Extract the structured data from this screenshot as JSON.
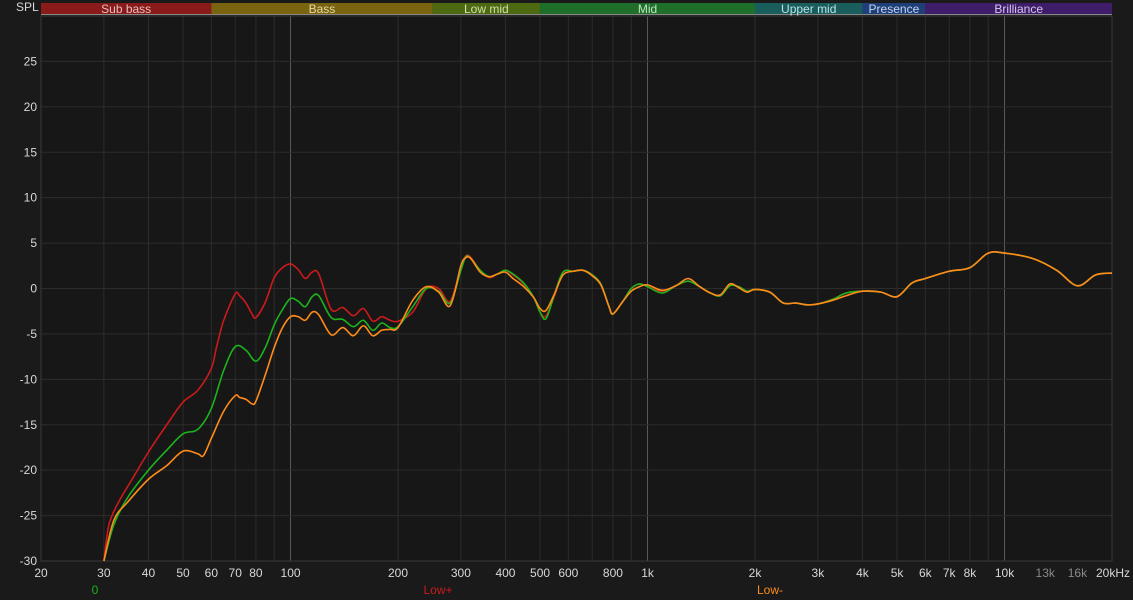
{
  "chart_data": {
    "type": "line",
    "title": "",
    "ylabel": "SPL",
    "xlabel": "",
    "x_scale": "log",
    "xlim": [
      20,
      20000
    ],
    "ylim": [
      -30,
      30
    ],
    "grid": true,
    "y_ticks": [
      25,
      20,
      15,
      10,
      5,
      0,
      -5,
      -10,
      -15,
      -20,
      -25,
      -30
    ],
    "x_ticks": [
      {
        "v": 20,
        "label": "20"
      },
      {
        "v": 30,
        "label": "30"
      },
      {
        "v": 40,
        "label": "40"
      },
      {
        "v": 50,
        "label": "50"
      },
      {
        "v": 60,
        "label": "60"
      },
      {
        "v": 70,
        "label": "70"
      },
      {
        "v": 80,
        "label": "80"
      },
      {
        "v": 100,
        "label": "100"
      },
      {
        "v": 200,
        "label": "200"
      },
      {
        "v": 300,
        "label": "300"
      },
      {
        "v": 400,
        "label": "400"
      },
      {
        "v": 500,
        "label": "500"
      },
      {
        "v": 600,
        "label": "600"
      },
      {
        "v": 800,
        "label": "800"
      },
      {
        "v": 1000,
        "label": "1k"
      },
      {
        "v": 2000,
        "label": "2k"
      },
      {
        "v": 3000,
        "label": "3k"
      },
      {
        "v": 4000,
        "label": "4k"
      },
      {
        "v": 5000,
        "label": "5k"
      },
      {
        "v": 6000,
        "label": "6k"
      },
      {
        "v": 7000,
        "label": "7k"
      },
      {
        "v": 8000,
        "label": "8k"
      },
      {
        "v": 10000,
        "label": "10k"
      },
      {
        "v": 13000,
        "label": "13k",
        "dim": true
      },
      {
        "v": 16000,
        "label": "16k",
        "dim": true
      },
      {
        "v": 20000,
        "label": "20kHz"
      }
    ],
    "bands": [
      {
        "label": "Sub bass",
        "from": 20,
        "to": 60,
        "color": "#8b1a1a",
        "text": "#e0c0c0"
      },
      {
        "label": "Bass",
        "from": 60,
        "to": 250,
        "color": "#7a6410",
        "text": "#e6d9a8"
      },
      {
        "label": "Low mid",
        "from": 250,
        "to": 500,
        "color": "#4d6a12",
        "text": "#cfe0a8"
      },
      {
        "label": "Mid",
        "from": 500,
        "to": 2000,
        "color": "#1f6e2a",
        "text": "#bfe6c2"
      },
      {
        "label": "Upper mid",
        "from": 2000,
        "to": 4000,
        "color": "#1a5d5d",
        "text": "#bde2e2"
      },
      {
        "label": "Presence",
        "from": 4000,
        "to": 6000,
        "color": "#1f3f78",
        "text": "#c8d4f0"
      },
      {
        "label": "Brilliance",
        "from": 6000,
        "to": 20000,
        "color": "#3f1d6a",
        "text": "#d6c8ec"
      }
    ],
    "legend": [
      {
        "label": "0",
        "color": "#1db31d"
      },
      {
        "label": "Low+",
        "color": "#cc1a1a"
      },
      {
        "label": "Low-",
        "color": "#ff8c1a"
      }
    ],
    "series": [
      {
        "name": "0",
        "color": "#1db31d",
        "points": [
          [
            30,
            -30
          ],
          [
            32,
            -26
          ],
          [
            35,
            -23
          ],
          [
            40,
            -20
          ],
          [
            45,
            -17.8
          ],
          [
            50,
            -16
          ],
          [
            55,
            -15.5
          ],
          [
            60,
            -13.2
          ],
          [
            65,
            -9
          ],
          [
            70,
            -6.4
          ],
          [
            75,
            -6.8
          ],
          [
            80,
            -8
          ],
          [
            85,
            -6.5
          ],
          [
            90,
            -4
          ],
          [
            95,
            -2.3
          ],
          [
            100,
            -1.1
          ],
          [
            105,
            -1.4
          ],
          [
            110,
            -2
          ],
          [
            115,
            -0.9
          ],
          [
            120,
            -0.8
          ],
          [
            130,
            -3.2
          ],
          [
            140,
            -3.4
          ],
          [
            150,
            -4.2
          ],
          [
            160,
            -3.5
          ],
          [
            170,
            -4.6
          ],
          [
            180,
            -3.8
          ],
          [
            190,
            -4.3
          ],
          [
            200,
            -4.2
          ],
          [
            220,
            -2
          ],
          [
            240,
            0
          ],
          [
            260,
            -0.3
          ],
          [
            280,
            -1.6
          ],
          [
            300,
            2
          ],
          [
            310,
            3.5
          ],
          [
            320,
            3.3
          ],
          [
            340,
            2
          ],
          [
            360,
            1.3
          ],
          [
            380,
            1.6
          ],
          [
            400,
            2
          ],
          [
            420,
            1.6
          ],
          [
            450,
            0.6
          ],
          [
            480,
            -1
          ],
          [
            500,
            -2.6
          ],
          [
            520,
            -3.3
          ],
          [
            550,
            -0.5
          ],
          [
            580,
            1.8
          ],
          [
            620,
            1.9
          ],
          [
            660,
            2
          ],
          [
            700,
            1.5
          ],
          [
            740,
            0.5
          ],
          [
            780,
            -2
          ],
          [
            800,
            -2.8
          ],
          [
            850,
            -1.5
          ],
          [
            900,
            0
          ],
          [
            950,
            0.5
          ],
          [
            1000,
            0.2
          ],
          [
            1100,
            -0.5
          ],
          [
            1200,
            0.3
          ],
          [
            1300,
            0.8
          ],
          [
            1400,
            0.2
          ],
          [
            1500,
            -0.5
          ],
          [
            1600,
            -0.8
          ],
          [
            1700,
            0.3
          ],
          [
            1800,
            0.2
          ],
          [
            1900,
            -0.3
          ],
          [
            2000,
            -0.1
          ],
          [
            2200,
            -0.4
          ],
          [
            2400,
            -1.6
          ],
          [
            2600,
            -1.6
          ],
          [
            2800,
            -1.8
          ],
          [
            3000,
            -1.7
          ],
          [
            3300,
            -1.2
          ],
          [
            3600,
            -0.5
          ],
          [
            4000,
            -0.3
          ],
          [
            4500,
            -0.4
          ],
          [
            5000,
            -0.9
          ],
          [
            5500,
            0.6
          ],
          [
            6000,
            1.1
          ],
          [
            7000,
            1.9
          ],
          [
            8000,
            2.3
          ],
          [
            9000,
            3.9
          ],
          [
            10000,
            3.9
          ],
          [
            12000,
            3.3
          ],
          [
            14000,
            2
          ],
          [
            16000,
            0.3
          ],
          [
            18000,
            1.5
          ],
          [
            20000,
            1.7
          ]
        ]
      },
      {
        "name": "Low+",
        "color": "#cc1a1a",
        "points": [
          [
            30,
            -30
          ],
          [
            31,
            -26
          ],
          [
            33,
            -23.5
          ],
          [
            36,
            -21
          ],
          [
            40,
            -18
          ],
          [
            45,
            -15
          ],
          [
            50,
            -12.5
          ],
          [
            55,
            -11.2
          ],
          [
            60,
            -8.8
          ],
          [
            62,
            -6.5
          ],
          [
            65,
            -3.5
          ],
          [
            70,
            -0.6
          ],
          [
            72,
            -0.8
          ],
          [
            75,
            -1.6
          ],
          [
            78,
            -2.8
          ],
          [
            80,
            -3.2
          ],
          [
            85,
            -1.5
          ],
          [
            90,
            1.2
          ],
          [
            95,
            2.3
          ],
          [
            100,
            2.7
          ],
          [
            105,
            2.1
          ],
          [
            110,
            1.1
          ],
          [
            115,
            1.8
          ],
          [
            120,
            1.6
          ],
          [
            130,
            -2.3
          ],
          [
            140,
            -2.1
          ],
          [
            150,
            -3
          ],
          [
            160,
            -2.2
          ],
          [
            170,
            -3.6
          ],
          [
            180,
            -3.1
          ],
          [
            190,
            -3.5
          ],
          [
            200,
            -3.6
          ],
          [
            220,
            -2.6
          ],
          [
            240,
            0
          ],
          [
            260,
            0
          ],
          [
            280,
            -1.4
          ],
          [
            300,
            2.3
          ],
          [
            310,
            3.6
          ],
          [
            320,
            3.4
          ],
          [
            340,
            2
          ],
          [
            360,
            1.2
          ],
          [
            380,
            1.6
          ],
          [
            400,
            2
          ],
          [
            420,
            1.5
          ],
          [
            450,
            0.5
          ],
          [
            480,
            -1
          ],
          [
            500,
            -2.6
          ],
          [
            520,
            -3
          ],
          [
            550,
            -0.7
          ],
          [
            580,
            1.8
          ],
          [
            620,
            1.9
          ],
          [
            660,
            2
          ],
          [
            700,
            1.5
          ],
          [
            740,
            0.5
          ],
          [
            780,
            -2
          ],
          [
            800,
            -2.8
          ],
          [
            850,
            -1.5
          ],
          [
            900,
            0
          ],
          [
            950,
            0.5
          ],
          [
            1000,
            0.2
          ],
          [
            1100,
            -0.3
          ],
          [
            1200,
            0.3
          ],
          [
            1300,
            0.8
          ],
          [
            1400,
            0.2
          ],
          [
            1500,
            -0.5
          ],
          [
            1600,
            -0.8
          ],
          [
            1700,
            0.3
          ],
          [
            1800,
            0.2
          ],
          [
            1900,
            -0.3
          ],
          [
            2000,
            -0.1
          ],
          [
            2200,
            -0.4
          ],
          [
            2400,
            -1.6
          ],
          [
            2600,
            -1.6
          ],
          [
            2800,
            -1.8
          ],
          [
            3000,
            -1.7
          ],
          [
            3300,
            -1.2
          ],
          [
            3600,
            -0.5
          ],
          [
            4000,
            -0.3
          ],
          [
            4500,
            -0.4
          ],
          [
            5000,
            -0.9
          ],
          [
            5500,
            0.6
          ],
          [
            6000,
            1.1
          ],
          [
            7000,
            1.9
          ],
          [
            8000,
            2.3
          ],
          [
            9000,
            3.9
          ],
          [
            10000,
            3.9
          ],
          [
            12000,
            3.3
          ],
          [
            14000,
            2
          ],
          [
            16000,
            0.3
          ],
          [
            18000,
            1.5
          ],
          [
            20000,
            1.7
          ]
        ]
      },
      {
        "name": "Low-",
        "color": "#ff8c1a",
        "points": [
          [
            30,
            -30
          ],
          [
            32,
            -25.5
          ],
          [
            35,
            -23.5
          ],
          [
            40,
            -21
          ],
          [
            45,
            -19.5
          ],
          [
            50,
            -17.9
          ],
          [
            55,
            -18.2
          ],
          [
            57,
            -18.4
          ],
          [
            60,
            -16.5
          ],
          [
            65,
            -13.5
          ],
          [
            70,
            -11.8
          ],
          [
            72,
            -12
          ],
          [
            75,
            -12.2
          ],
          [
            78,
            -12.7
          ],
          [
            80,
            -12.4
          ],
          [
            85,
            -9.5
          ],
          [
            90,
            -6.5
          ],
          [
            95,
            -4.3
          ],
          [
            100,
            -3.1
          ],
          [
            105,
            -3.1
          ],
          [
            110,
            -3.5
          ],
          [
            115,
            -2.6
          ],
          [
            120,
            -2.9
          ],
          [
            130,
            -5.1
          ],
          [
            140,
            -4.3
          ],
          [
            150,
            -5.2
          ],
          [
            160,
            -4.1
          ],
          [
            170,
            -5.2
          ],
          [
            180,
            -4.6
          ],
          [
            190,
            -4.5
          ],
          [
            200,
            -4.3
          ],
          [
            220,
            -1.3
          ],
          [
            240,
            0.2
          ],
          [
            260,
            -0.4
          ],
          [
            280,
            -1.9
          ],
          [
            300,
            2.5
          ],
          [
            310,
            3.4
          ],
          [
            320,
            3.3
          ],
          [
            340,
            1.8
          ],
          [
            360,
            1.3
          ],
          [
            380,
            1.6
          ],
          [
            400,
            1.8
          ],
          [
            420,
            1.1
          ],
          [
            450,
            0.2
          ],
          [
            480,
            -1
          ],
          [
            500,
            -2.2
          ],
          [
            520,
            -2.4
          ],
          [
            550,
            -0.5
          ],
          [
            580,
            1.5
          ],
          [
            620,
            1.9
          ],
          [
            660,
            2
          ],
          [
            700,
            1.4
          ],
          [
            740,
            0.4
          ],
          [
            780,
            -2
          ],
          [
            800,
            -2.8
          ],
          [
            850,
            -1.5
          ],
          [
            900,
            -0.3
          ],
          [
            950,
            0.2
          ],
          [
            1000,
            0.4
          ],
          [
            1100,
            -0.2
          ],
          [
            1200,
            0.3
          ],
          [
            1300,
            1.1
          ],
          [
            1400,
            0.2
          ],
          [
            1500,
            -0.5
          ],
          [
            1600,
            -0.7
          ],
          [
            1700,
            0.5
          ],
          [
            1800,
            0.1
          ],
          [
            1900,
            -0.4
          ],
          [
            2000,
            -0.1
          ],
          [
            2200,
            -0.4
          ],
          [
            2400,
            -1.6
          ],
          [
            2600,
            -1.6
          ],
          [
            2800,
            -1.8
          ],
          [
            3000,
            -1.7
          ],
          [
            3300,
            -1.3
          ],
          [
            3600,
            -0.8
          ],
          [
            4000,
            -0.3
          ],
          [
            4500,
            -0.4
          ],
          [
            5000,
            -0.9
          ],
          [
            5500,
            0.6
          ],
          [
            6000,
            1.1
          ],
          [
            7000,
            1.9
          ],
          [
            8000,
            2.3
          ],
          [
            9000,
            3.9
          ],
          [
            10000,
            3.9
          ],
          [
            12000,
            3.3
          ],
          [
            14000,
            2
          ],
          [
            16000,
            0.3
          ],
          [
            18000,
            1.5
          ],
          [
            20000,
            1.7
          ]
        ]
      }
    ]
  }
}
